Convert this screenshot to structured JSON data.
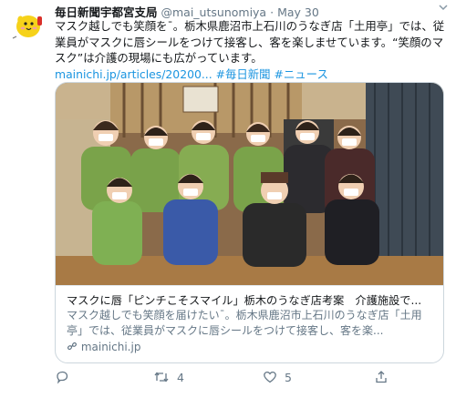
{
  "tweet": {
    "name": "毎日新聞宇都宮支局",
    "handle": "@mai_utsunomiya",
    "separator": "·",
    "date": "May 30",
    "text": "マスク越しでも笑顔を¯。栃木県鹿沼市上石川のうなぎ店「土用亭」では、従業員がマスクに唇シールをつけて接客し、客を楽しませています。“笑顔のマスク”は介護の現場にも広がっています。",
    "link_text": "mainichi.jp/articles/20200...",
    "hashtags": "#毎日新聞 #ニュース"
  },
  "card": {
    "title": "マスクに唇「ピンチこそスマイル」栃木のうなぎ店考案　介護施設で...",
    "description": "マスク越しでも笑顔を届けたい¯。栃木県鹿沼市上石川のうなぎ店「土用亭」では、従業員がマスクに唇シールをつけて接客し、客を楽...",
    "domain": "mainichi.jp"
  },
  "actions": {
    "reply_count": "",
    "retweet_count": "4",
    "like_count": "5",
    "share_count": ""
  },
  "icons": {
    "avatar": "yellow-bird-mascot-icon",
    "more": "chevron-down-icon",
    "reply": "comment-icon",
    "retweet": "retweet-icon",
    "like": "heart-icon",
    "share": "share-icon",
    "domain": "link-icon"
  },
  "colors": {
    "link": "#1b95e0",
    "secondary_text": "#657786",
    "border": "#ccd6dd"
  }
}
